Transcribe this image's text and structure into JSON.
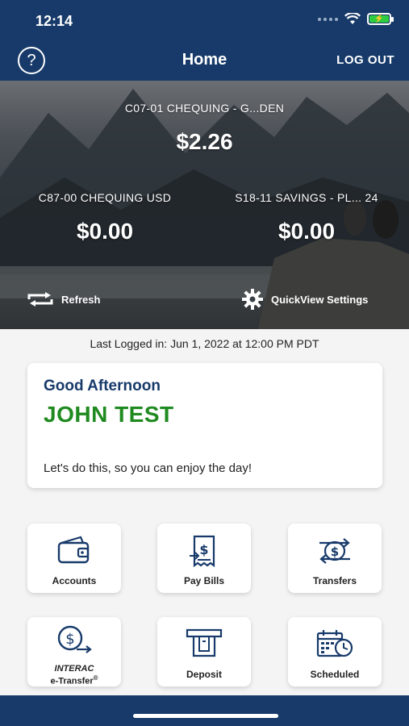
{
  "status": {
    "time": "12:14"
  },
  "nav": {
    "help_label": "?",
    "title": "Home",
    "logout_label": "LOG OUT"
  },
  "accounts": {
    "primary": {
      "name": "C07-01 CHEQUING - G...DEN",
      "balance": "$2.26"
    },
    "left": {
      "name": "C87-00 CHEQUING USD",
      "balance": "$0.00"
    },
    "right": {
      "name": "S18-11 SAVINGS - PL... 24",
      "balance": "$0.00"
    }
  },
  "actions": {
    "refresh_label": "Refresh",
    "quickview_label": "QuickView Settings"
  },
  "last_login": "Last Logged in: Jun 1, 2022 at 12:00 PM  PDT",
  "greeting": {
    "salutation": "Good Afternoon",
    "name": "JOHN TEST",
    "message": "Let's do this, so you can enjoy the day!"
  },
  "tiles": [
    {
      "label": "Accounts",
      "icon": "wallet-icon"
    },
    {
      "label": "Pay Bills",
      "icon": "bill-icon"
    },
    {
      "label": "Transfers",
      "icon": "transfer-icon"
    },
    {
      "label_line1": "INTERAC",
      "label_line2": "e-Transfer",
      "label_mark": "®",
      "icon": "etransfer-icon"
    },
    {
      "label": "Deposit",
      "icon": "atm-icon"
    },
    {
      "label": "Scheduled",
      "icon": "calendar-clock-icon"
    }
  ],
  "colors": {
    "navy": "#173a6a",
    "green": "#1f8a1f"
  }
}
